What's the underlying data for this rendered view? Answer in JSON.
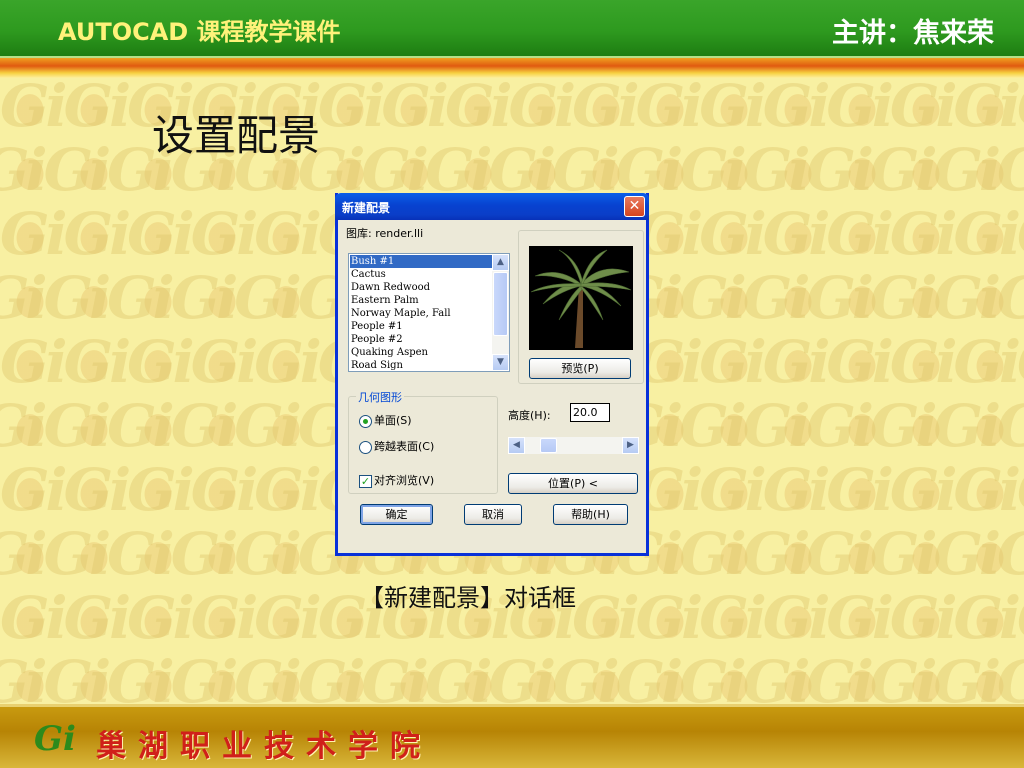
{
  "header": {
    "title": "AUTOCAD 课程教学课件",
    "presenter": "主讲：焦来荣"
  },
  "slide": {
    "title": "设置配景",
    "caption": "【新建配景】对话框"
  },
  "footer": {
    "logo": "Gi",
    "school": "巢湖职业技术学院"
  },
  "dialog": {
    "title": "新建配景",
    "library_label": "图库:  render.lli",
    "list_items": [
      "Bush #1",
      "Cactus",
      "Dawn Redwood",
      "Eastern Palm",
      "Norway Maple, Fall",
      "People #1",
      "People #2",
      "Quaking Aspen",
      "Road Sign"
    ],
    "selected_index": 0,
    "preview_button": "预览(P)",
    "geometry_group": "几何图形",
    "radio_single": "单面(S)",
    "radio_cross": "跨越表面(C)",
    "selected_geometry": "单面(S)",
    "align_view": "对齐浏览(V)",
    "align_view_checked": true,
    "height_label": "高度(H):",
    "height_value": "20.0",
    "position_button": "位置(P) <",
    "ok_button": "确定",
    "cancel_button": "取消",
    "help_button": "帮助(H)"
  },
  "colors": {
    "header_green": "#2e9a1f",
    "titlebar_blue": "#0842d0",
    "dialog_bg": "#ece9d8",
    "footer_gold": "#b78405",
    "footer_text_red": "#d0201a"
  }
}
